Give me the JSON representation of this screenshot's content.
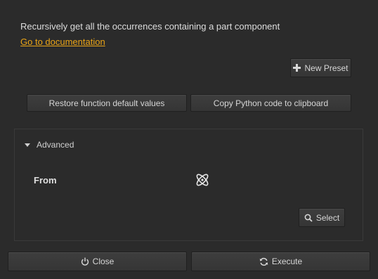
{
  "header": {
    "description": "Recursively get all the occurrences containing a part component",
    "doc_link": "Go to documentation"
  },
  "toolbar": {
    "new_preset_label": "New Preset",
    "new_preset_icon": "plus-icon",
    "restore_label": "Restore function default values",
    "copy_label": "Copy Python code to clipboard"
  },
  "advanced": {
    "label": "Advanced",
    "expanded": true,
    "from_label": "From",
    "from_icon": "part-component-icon",
    "select_label": "Select",
    "select_icon": "search-icon"
  },
  "footer": {
    "close_label": "Close",
    "close_icon": "power-icon",
    "execute_label": "Execute",
    "execute_icon": "refresh-icon"
  },
  "colors": {
    "background": "#2b2b2b",
    "link": "#e8a317",
    "button": "#3a3a3a"
  }
}
